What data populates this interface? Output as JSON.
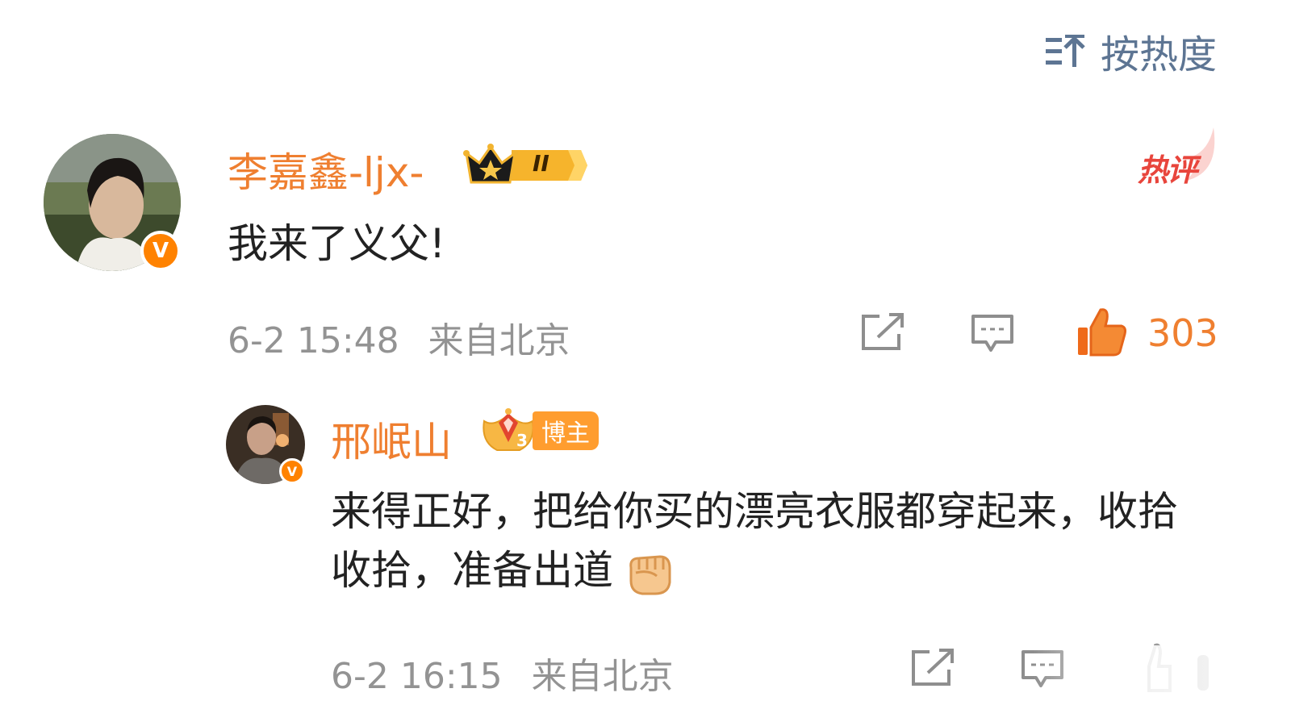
{
  "sort": {
    "label": "按热度",
    "icon": "sort-icon"
  },
  "comments": [
    {
      "username": "李嘉鑫-ljx-",
      "verified": true,
      "membership_badge_level": "II",
      "hot_badge": "热评",
      "text": "我来了义父!",
      "date": "6-2 15:48",
      "location": "来自北京",
      "like_count": "303",
      "like_active": true,
      "accent": "#ef7f30"
    }
  ],
  "reply": {
    "username": "邢岷山",
    "verified": true,
    "fan_level": "3",
    "author_tag": "博主",
    "text": "来得正好，把给你买的漂亮衣服都穿起来，收拾收拾，准备出道",
    "emoji": "fist-emoji",
    "date": "6-2 16:15",
    "location": "来自北京"
  },
  "colors": {
    "username": "#ef7f30",
    "meta": "#939393",
    "sort": "#5d7593",
    "verified": "#ff8200",
    "hot": "#e8453c"
  }
}
